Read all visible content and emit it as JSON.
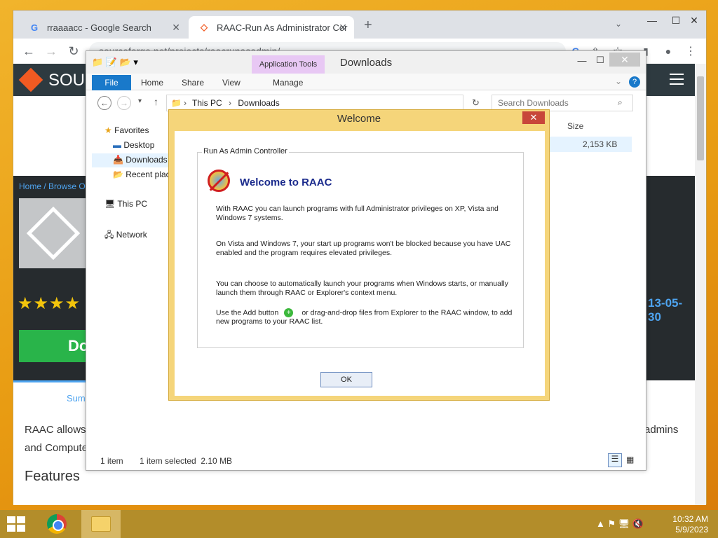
{
  "browser": {
    "tabs": [
      {
        "title": "rraaaacc - Google Search",
        "favicon": "G"
      },
      {
        "title": "RAAC-Run As Administrator Cor",
        "favicon": "◇"
      }
    ],
    "new_tab": "+",
    "url": "sourceforge.net/projects/raacrunasadmin/",
    "window_controls": {
      "minimize": "—",
      "maximize": "☐",
      "close": "✕"
    }
  },
  "sourceforge": {
    "brand": "SOU",
    "breadcrumb": "Home / Browse Op",
    "stars": "★★★★",
    "download_fragment": "Do",
    "date_fragment": "13-05-30",
    "summary_tab": "Summ",
    "desc_line1": "RAAC allows",
    "desc_line2": "and Compute",
    "desc_right": "admins",
    "features_heading": "Features"
  },
  "explorer": {
    "title": "Downloads",
    "app_tools": "Application Tools",
    "ribbon": {
      "file": "File",
      "home": "Home",
      "share": "Share",
      "view": "View",
      "manage": "Manage"
    },
    "address": {
      "pc": "This PC",
      "folder": "Downloads"
    },
    "search_placeholder": "Search Downloads",
    "nav": {
      "favorites": "Favorites",
      "desktop": "Desktop",
      "downloads": "Downloads",
      "recent": "Recent plac",
      "thispc": "This PC",
      "network": "Network"
    },
    "columns": {
      "size": "Size"
    },
    "file_size": "2,153 KB",
    "status": {
      "count": "1 item",
      "selected": "1 item selected  2.10 MB"
    }
  },
  "dialog": {
    "title": "Welcome",
    "group_label": "Run As Admin Controller",
    "heading": "Welcome to RAAC",
    "p1": "With RAAC you can launch programs with full Administrator privileges on XP, Vista and Windows 7 systems.",
    "p2": "On Vista and Windows 7, your start up programs won't be blocked because you have UAC enabled and the program requires elevated privileges.",
    "p3": "You can choose to automatically launch your programs when Windows starts, or manually launch them through RAAC or Explorer's context menu.",
    "p4a": "Use the Add button",
    "p4b": "or drag-and-drop files from Explorer to the RAAC window, to add new programs to your RAAC list.",
    "ok": "OK",
    "close": "✕"
  },
  "taskbar": {
    "time": "10:32 AM",
    "date": "5/9/2023",
    "tray": "▲ ⚑ 🖥 🔇"
  },
  "colors": {
    "desktop": "#e89b12",
    "dialog_frame": "#f5d57a",
    "sf_dark": "#262b2e",
    "accent_blue": "#1979ca",
    "raac_heading": "#1a2a8c"
  }
}
